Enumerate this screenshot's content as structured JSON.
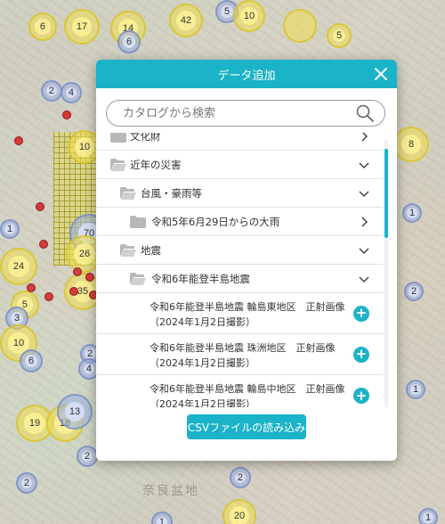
{
  "map": {
    "labels": [
      "奈良盆地"
    ],
    "clusters": [
      "6",
      "17",
      "42",
      "5",
      "10",
      "14",
      "6",
      "5",
      "2",
      "4",
      "10",
      "8",
      "1",
      "24",
      "5",
      "70",
      "26",
      "35",
      "3",
      "10",
      "2",
      "1",
      "2",
      "6",
      "4",
      "19",
      "18",
      "13",
      "2",
      "1",
      "1",
      "20",
      "2",
      "2",
      "1"
    ]
  },
  "dialog": {
    "title": "データ追加",
    "close_icon": "close-icon",
    "accent_color": "#1bb3c7"
  },
  "search": {
    "placeholder": "カタログから検索",
    "value": ""
  },
  "tree": {
    "nodes": [
      {
        "label": "文化財",
        "state": "collapsed"
      },
      {
        "label": "近年の災害",
        "state": "expanded"
      },
      {
        "label": "台風・豪雨等",
        "state": "expanded"
      },
      {
        "label": "令和5年6月29日からの大雨",
        "state": "collapsed"
      },
      {
        "label": "地震",
        "state": "expanded"
      },
      {
        "label": "令和6年能登半島地震",
        "state": "expanded"
      }
    ],
    "items": [
      {
        "line1": "令和6年能登半島地震 輪島東地区　正射画像",
        "line2": "（2024年1月2日撮影）"
      },
      {
        "line1": "令和6年能登半島地震 珠洲地区　正射画像",
        "line2": "（2024年1月2日撮影）"
      },
      {
        "line1": "令和6年能登半島地震 輪島中地区　正射画像",
        "line2": "（2024年1月2日撮影）"
      }
    ]
  },
  "csv_button": {
    "label": "CSVファイルの読み込み"
  }
}
